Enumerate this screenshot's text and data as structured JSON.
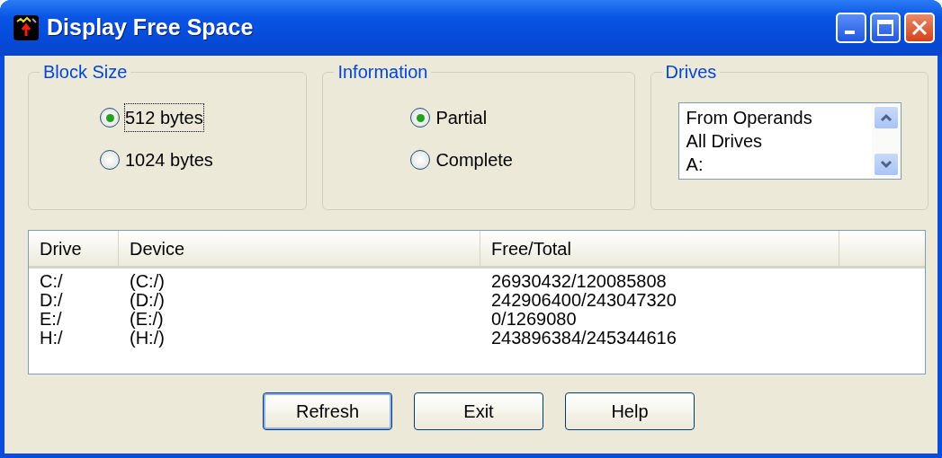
{
  "window": {
    "title": "Display Free Space"
  },
  "groups": [
    {
      "title": "Block Size",
      "options": [
        {
          "label": "512 bytes",
          "selected": true,
          "focused": true
        },
        {
          "label": "1024 bytes",
          "selected": false,
          "focused": false
        }
      ]
    },
    {
      "title": "Information",
      "options": [
        {
          "label": "Partial",
          "selected": true,
          "focused": false
        },
        {
          "label": "Complete",
          "selected": false,
          "focused": false
        }
      ]
    }
  ],
  "drives": {
    "title": "Drives",
    "items": [
      "From Operands",
      "All Drives",
      "A:"
    ]
  },
  "table": {
    "columns": [
      "Drive",
      "Device",
      "Free/Total"
    ],
    "rows": [
      [
        "C:/",
        "(C:/)",
        "26930432/120085808"
      ],
      [
        "D:/",
        "(D:/)",
        "242906400/243047320"
      ],
      [
        "E:/",
        "(E:/)",
        "0/1269080"
      ],
      [
        "H:/",
        "(H:/)",
        "243896384/245344616"
      ]
    ]
  },
  "buttons": [
    {
      "label": "Refresh",
      "default": true
    },
    {
      "label": "Exit",
      "default": false
    },
    {
      "label": "Help",
      "default": false
    }
  ]
}
